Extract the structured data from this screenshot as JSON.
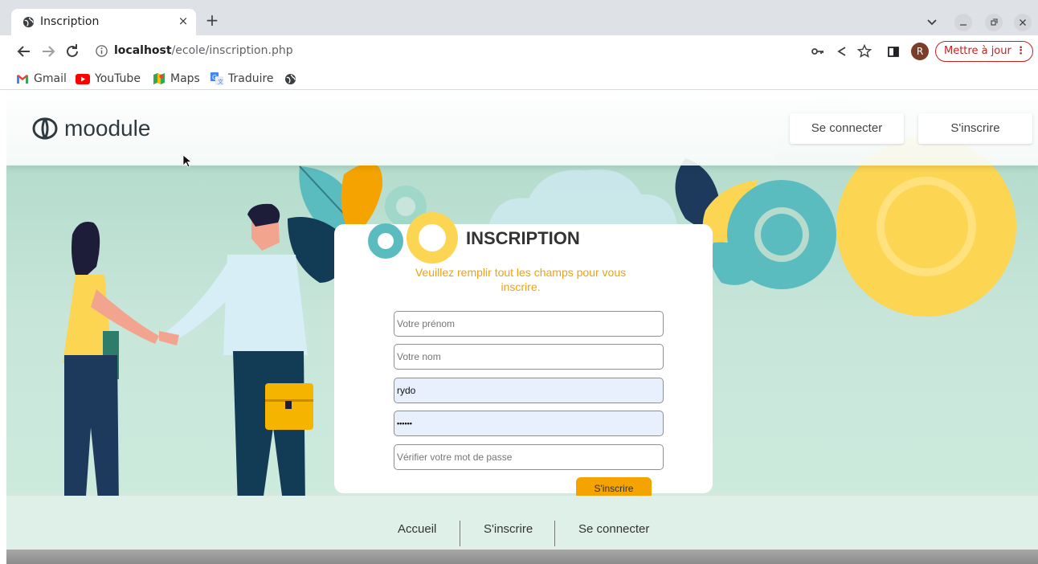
{
  "browser": {
    "tab_title": "Inscription",
    "tab_close": "×",
    "new_tab": "+",
    "url_host": "localhost",
    "url_path": "/ecole/inscription.php",
    "profile_initial": "R",
    "update_label": "Mettre à jour",
    "update_menu": "⋮",
    "bookmarks": [
      {
        "label": "Gmail",
        "icon": "gmail-icon"
      },
      {
        "label": "YouTube",
        "icon": "youtube-icon"
      },
      {
        "label": "Maps",
        "icon": "maps-icon"
      },
      {
        "label": "Traduire",
        "icon": "translate-icon"
      }
    ]
  },
  "site": {
    "logo_text": "moodule",
    "login_label": "Se connecter",
    "signup_label": "S'inscrire"
  },
  "form": {
    "title": "INSCRIPTION",
    "subtitle": "Veuillez remplir tout les champs pour vous inscrire.",
    "firstname_placeholder": "Votre prénom",
    "lastname_placeholder": "Votre nom",
    "username_value": "rydo",
    "password_value": "••••••",
    "confirm_placeholder": "Vérifier votre mot de passe",
    "submit_label": "S'inscrire"
  },
  "footer": {
    "links": [
      "Accueil",
      "S'inscrire",
      "Se connecter"
    ]
  },
  "colors": {
    "accent": "#f5a300",
    "teal": "#5bbcbf",
    "yellow": "#fcd553",
    "navy": "#1d3a5c"
  }
}
